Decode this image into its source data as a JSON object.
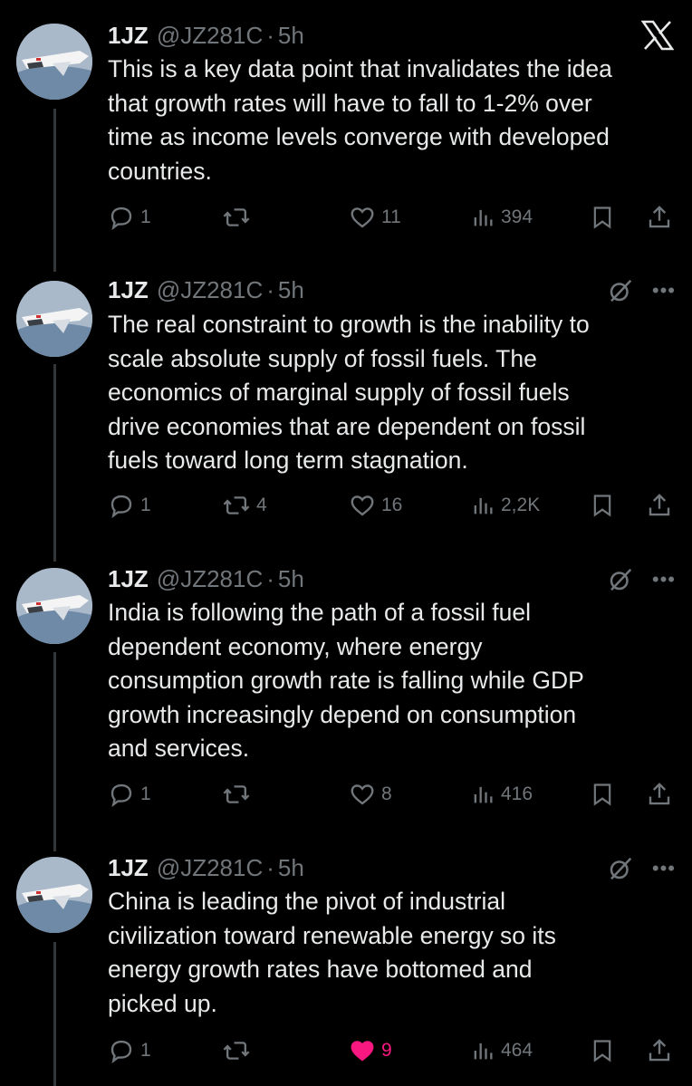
{
  "close_label": "X",
  "tweets": [
    {
      "name": "1JZ",
      "handle": "@JZ281C",
      "separator": "·",
      "time": "5h",
      "text": "This is a key data point that invalidates the idea\nthat growth rates will have to fall to 1-2% over\ntime as income levels converge with developed\ncountries.",
      "replies": "1",
      "reposts": "",
      "likes": "11",
      "views": "394",
      "liked": false
    },
    {
      "name": "1JZ",
      "handle": "@JZ281C",
      "separator": "·",
      "time": "5h",
      "text": "The real constraint to growth is the inability to\nscale absolute supply of fossil fuels. The\neconomics of marginal supply of fossil fuels\ndrive economies that are dependent on fossil\nfuels toward long term stagnation.",
      "replies": "1",
      "reposts": "4",
      "likes": "16",
      "views": "2,2K",
      "liked": false
    },
    {
      "name": "1JZ",
      "handle": "@JZ281C",
      "separator": "·",
      "time": "5h",
      "text": "India is following the path of a fossil fuel\ndependent economy, where energy\nconsumption growth rate is falling while GDP\ngrowth increasingly depend on consumption\nand services.",
      "replies": "1",
      "reposts": "",
      "likes": "8",
      "views": "416",
      "liked": false
    },
    {
      "name": "1JZ",
      "handle": "@JZ281C",
      "separator": "·",
      "time": "5h",
      "text": "China is leading the pivot of industrial\ncivilization toward renewable energy so its\nenergy growth rates have bottomed and\npicked up.",
      "replies": "1",
      "reposts": "",
      "likes": "9",
      "views": "464",
      "liked": true
    }
  ],
  "colors": {
    "background": "#000000",
    "text": "#e7e9ea",
    "secondary": "#71767b",
    "like": "#f91880"
  }
}
